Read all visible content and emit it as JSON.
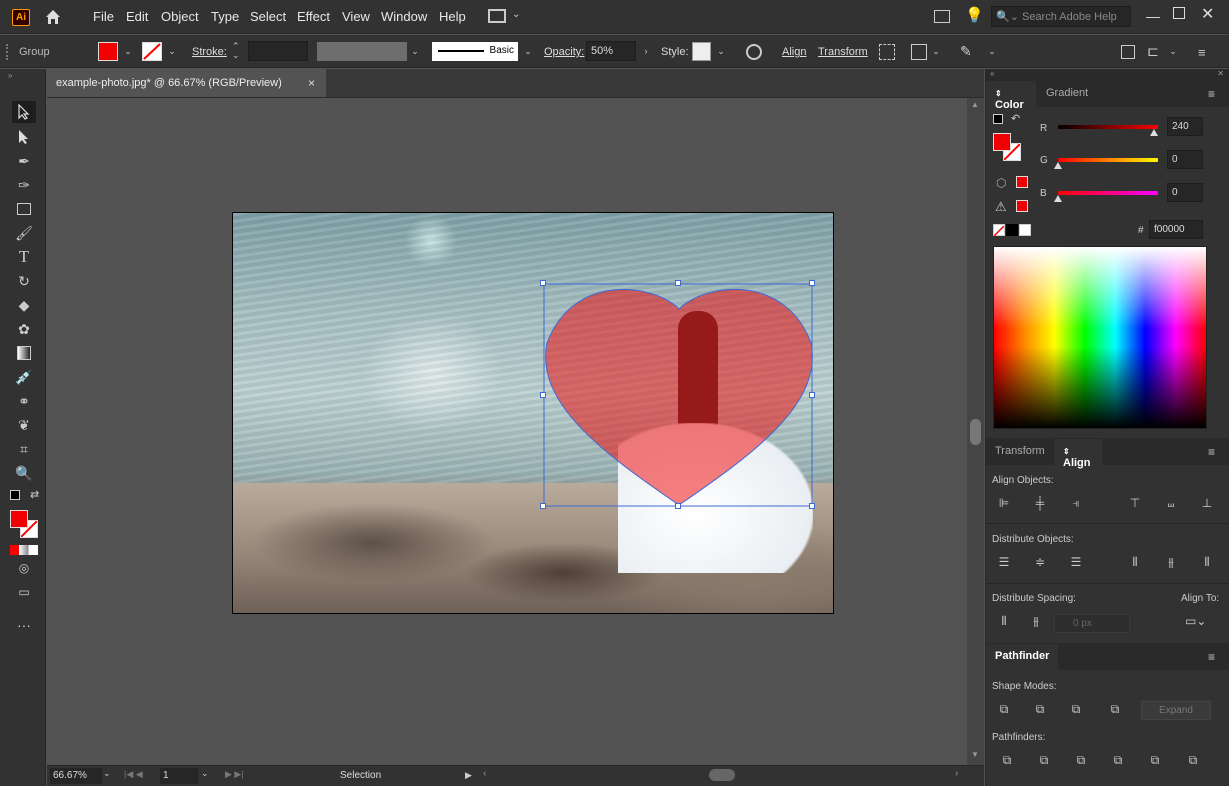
{
  "menubar": {
    "app_logo": "Ai",
    "items": [
      "File",
      "Edit",
      "Object",
      "Type",
      "Select",
      "Effect",
      "View",
      "Window",
      "Help"
    ],
    "search_placeholder": "Search Adobe Help"
  },
  "control": {
    "selection_label": "Group",
    "stroke_label": "Stroke:",
    "brush_label": "Basic",
    "opacity_label": "Opacity:",
    "opacity_value": "50%",
    "style_label": "Style:",
    "align_label": "Align",
    "transform_label": "Transform",
    "fill_color": "#f00000"
  },
  "document": {
    "tab_title": "example-photo.jpg* @ 66.67% (RGB/Preview)",
    "close_glyph": "×"
  },
  "color_panel": {
    "tabs": [
      "Color",
      "Gradient"
    ],
    "r_label": "R",
    "g_label": "G",
    "b_label": "B",
    "r_value": "240",
    "g_value": "0",
    "b_value": "0",
    "hex_prefix": "#",
    "hex_value": "f00000"
  },
  "align_panel": {
    "tabs": [
      "Transform",
      "Align"
    ],
    "align_objects": "Align Objects:",
    "distribute_objects": "Distribute Objects:",
    "distribute_spacing": "Distribute Spacing:",
    "align_to": "Align To:",
    "spacing_value": "0 px"
  },
  "pathfinder_panel": {
    "tab": "Pathfinder",
    "shape_modes": "Shape Modes:",
    "pathfinders": "Pathfinders:",
    "expand_label": "Expand"
  },
  "status": {
    "zoom": "66.67%",
    "artboard_num": "1",
    "tool_name": "Selection"
  }
}
